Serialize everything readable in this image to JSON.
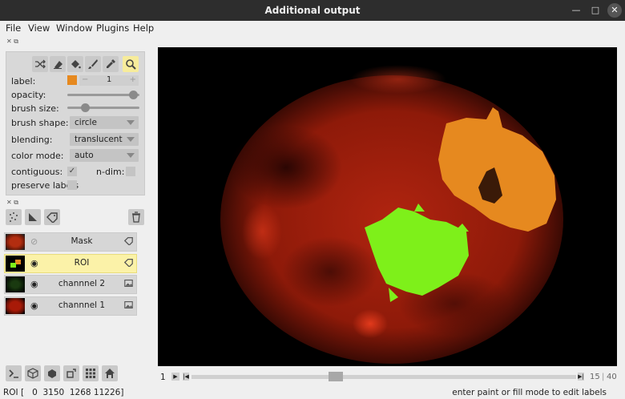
{
  "window": {
    "title": "Additional output",
    "min_icon": "minimize-icon",
    "max_icon": "maximize-icon",
    "close_icon": "close-icon"
  },
  "menu": {
    "items": [
      "File",
      "View",
      "Window",
      "Plugins",
      "Help"
    ]
  },
  "layer_controls": {
    "tools": [
      "shuffle-icon",
      "eraser-icon",
      "fill-bucket-icon",
      "paintbrush-icon",
      "color-picker-icon",
      "zoom-icon"
    ],
    "label": {
      "name": "label:",
      "color": "#e6891f",
      "minus": "−",
      "value": "1",
      "plus": "+"
    },
    "opacity": {
      "name": "opacity:",
      "value": 1.0
    },
    "brush_size": {
      "name": "brush size:",
      "value": 0.2
    },
    "brush_shape": {
      "name": "brush shape:",
      "value": "circle"
    },
    "blending": {
      "name": "blending:",
      "value": "translucent"
    },
    "color_mode": {
      "name": "color mode:",
      "value": "auto"
    },
    "contiguous": {
      "name": "contiguous:",
      "checked": true
    },
    "n_dim": {
      "name": "n-dim:",
      "checked": false
    },
    "preserve_labels": {
      "name": "preserve labels",
      "checked": false
    }
  },
  "layer_list": {
    "tools": [
      "new-points-icon",
      "new-shapes-icon",
      "new-labels-icon",
      "delete-layer-icon"
    ],
    "layers": [
      {
        "name": "Mask",
        "visible": false,
        "type_icon": "label-tag-icon",
        "selected": false
      },
      {
        "name": "ROI",
        "visible": true,
        "type_icon": "label-tag-icon",
        "selected": true
      },
      {
        "name": "channnel 2",
        "visible": true,
        "type_icon": "image-icon",
        "selected": false
      },
      {
        "name": "channnel 1",
        "visible": true,
        "type_icon": "image-icon",
        "selected": false
      }
    ]
  },
  "viewer_buttons": [
    "console-icon",
    "ndisplay-3d-icon",
    "roll-dims-icon",
    "transpose-icon",
    "grid-icon",
    "home-icon"
  ],
  "dims": {
    "axis": "1",
    "current": "15",
    "max": "40"
  },
  "status": {
    "left": "ROI [   0  3150  1268 11226]",
    "right": "enter paint or fill mode to edit labels"
  },
  "colors": {
    "orange_label": "#e6891f",
    "green_label": "#7ef01a",
    "selected_layer": "#fbf2a8"
  }
}
